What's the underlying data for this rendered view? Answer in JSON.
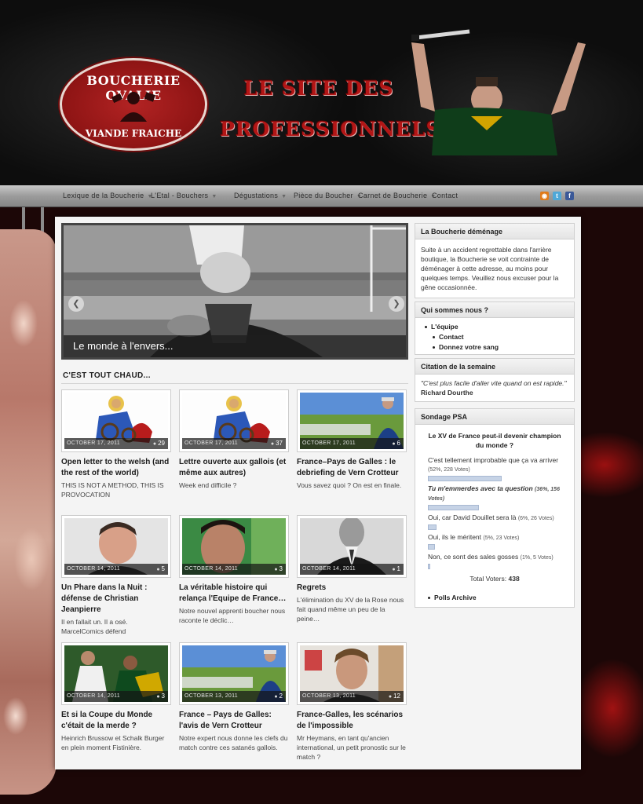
{
  "header": {
    "logo_top": "BOUCHERIE OVALIE",
    "logo_bottom": "VIANDE FRAICHE",
    "tagline_1": "LE SITE DES",
    "tagline_2": "PROFESSIONNELS"
  },
  "nav": {
    "items": [
      {
        "label": "Lexique de la Boucherie"
      },
      {
        "label": "L'Etal - Bouchers"
      },
      {
        "label": "Dégustations"
      },
      {
        "label": "Pièce du Boucher"
      },
      {
        "label": "Carnet de Boucherie"
      },
      {
        "label": "Contact"
      }
    ],
    "social": [
      "rss-icon",
      "twitter-icon",
      "facebook-icon"
    ]
  },
  "slider": {
    "caption": "Le monde à l'envers..."
  },
  "section": {
    "title": "C'EST TOUT CHAUD..."
  },
  "posts": [
    {
      "date": "OCTOBER 17, 2011",
      "comments": "29",
      "title": "Open letter to the welsh (and the rest of the world)",
      "excerpt": "THIS IS NOT A METHOD, THIS IS PROVOCATION"
    },
    {
      "date": "OCTOBER 17, 2011",
      "comments": "37",
      "title": "Lettre ouverte aux gallois (et même aux autres)",
      "excerpt": "Week end difficile ?"
    },
    {
      "date": "OCTOBER 17, 2011",
      "comments": "6",
      "title": "France–Pays de Galles : le debriefing de Vern Crotteur",
      "excerpt": "Vous savez quoi ? On est en finale."
    },
    {
      "date": "OCTOBER 14, 2011",
      "comments": "5",
      "title": "Un Phare dans la Nuit : défense de Christian Jeanpierre",
      "excerpt": "Il en fallait un. Il a osé. MarcelComics défend"
    },
    {
      "date": "OCTOBER 14, 2011",
      "comments": "3",
      "title": "La véritable histoire qui relança l'Equipe de France…",
      "excerpt": "Notre nouvel apprenti boucher nous raconte le déclic…"
    },
    {
      "date": "OCTOBER 14, 2011",
      "comments": "1",
      "title": "Regrets",
      "excerpt": "L'élimination du XV de la Rose nous fait quand même un peu de la peine…"
    },
    {
      "date": "OCTOBER 14, 2011",
      "comments": "3",
      "title": "Et si la Coupe du Monde c'était de la merde ?",
      "excerpt": "Heinrich Brussow et Schalk Burger en plein moment Fistinière."
    },
    {
      "date": "OCTOBER 13, 2011",
      "comments": "2",
      "title": "France – Pays de Galles: l'avis de Vern Crotteur",
      "excerpt": "Notre expert nous donne les clefs du match contre ces satanés gallois."
    },
    {
      "date": "OCTOBER 13, 2011",
      "comments": "12",
      "title": "France-Galles, les scénarios de l'impossible",
      "excerpt": "Mr Heymans, en tant qu'ancien international, un petit pronostic sur le match ?"
    }
  ],
  "sidebar": {
    "moving": {
      "title": "La Boucherie déménage",
      "text": "Suite à un accident regrettable dans l'arrière boutique, la Boucherie se voit contrainte de déménager à cette adresse, au moins pour quelques temps. Veuillez nous excuser pour la gêne occasionnée."
    },
    "about": {
      "title": "Qui sommes nous ?",
      "items": [
        "L'équipe",
        "Contact",
        "Donnez votre sang"
      ]
    },
    "quote": {
      "title": "Citation de la semaine",
      "text": "\"C'est plus facile d'aller vite quand on est rapide.\"",
      "author": "Richard Dourthe"
    },
    "poll": {
      "title": "Sondage PSA",
      "question": "Le XV de France peut-il devenir champion du monde ?",
      "options": [
        {
          "label": "C'est tellement improbable que ça va arriver",
          "pct_text": "(52%, 228 Votes)",
          "pct": 52
        },
        {
          "label": "Tu m'emmerdes avec ta question",
          "pct_text": "(36%, 156 Votes)",
          "pct": 36
        },
        {
          "label": "Oui, car David Douillet sera là",
          "pct_text": "(6%, 26 Votes)",
          "pct": 6
        },
        {
          "label": "Oui, ils le méritent",
          "pct_text": "(5%, 23 Votes)",
          "pct": 5
        },
        {
          "label": "Non, ce sont des sales gosses",
          "pct_text": "(1%, 5 Votes)",
          "pct": 1
        }
      ],
      "total_label": "Total Voters:",
      "total": "438",
      "archive": "Polls Archive"
    }
  },
  "colors": {
    "accent_red": "#b31616",
    "nav_bg": "#9c9c9c",
    "panel_bg": "#f4f4f4"
  }
}
